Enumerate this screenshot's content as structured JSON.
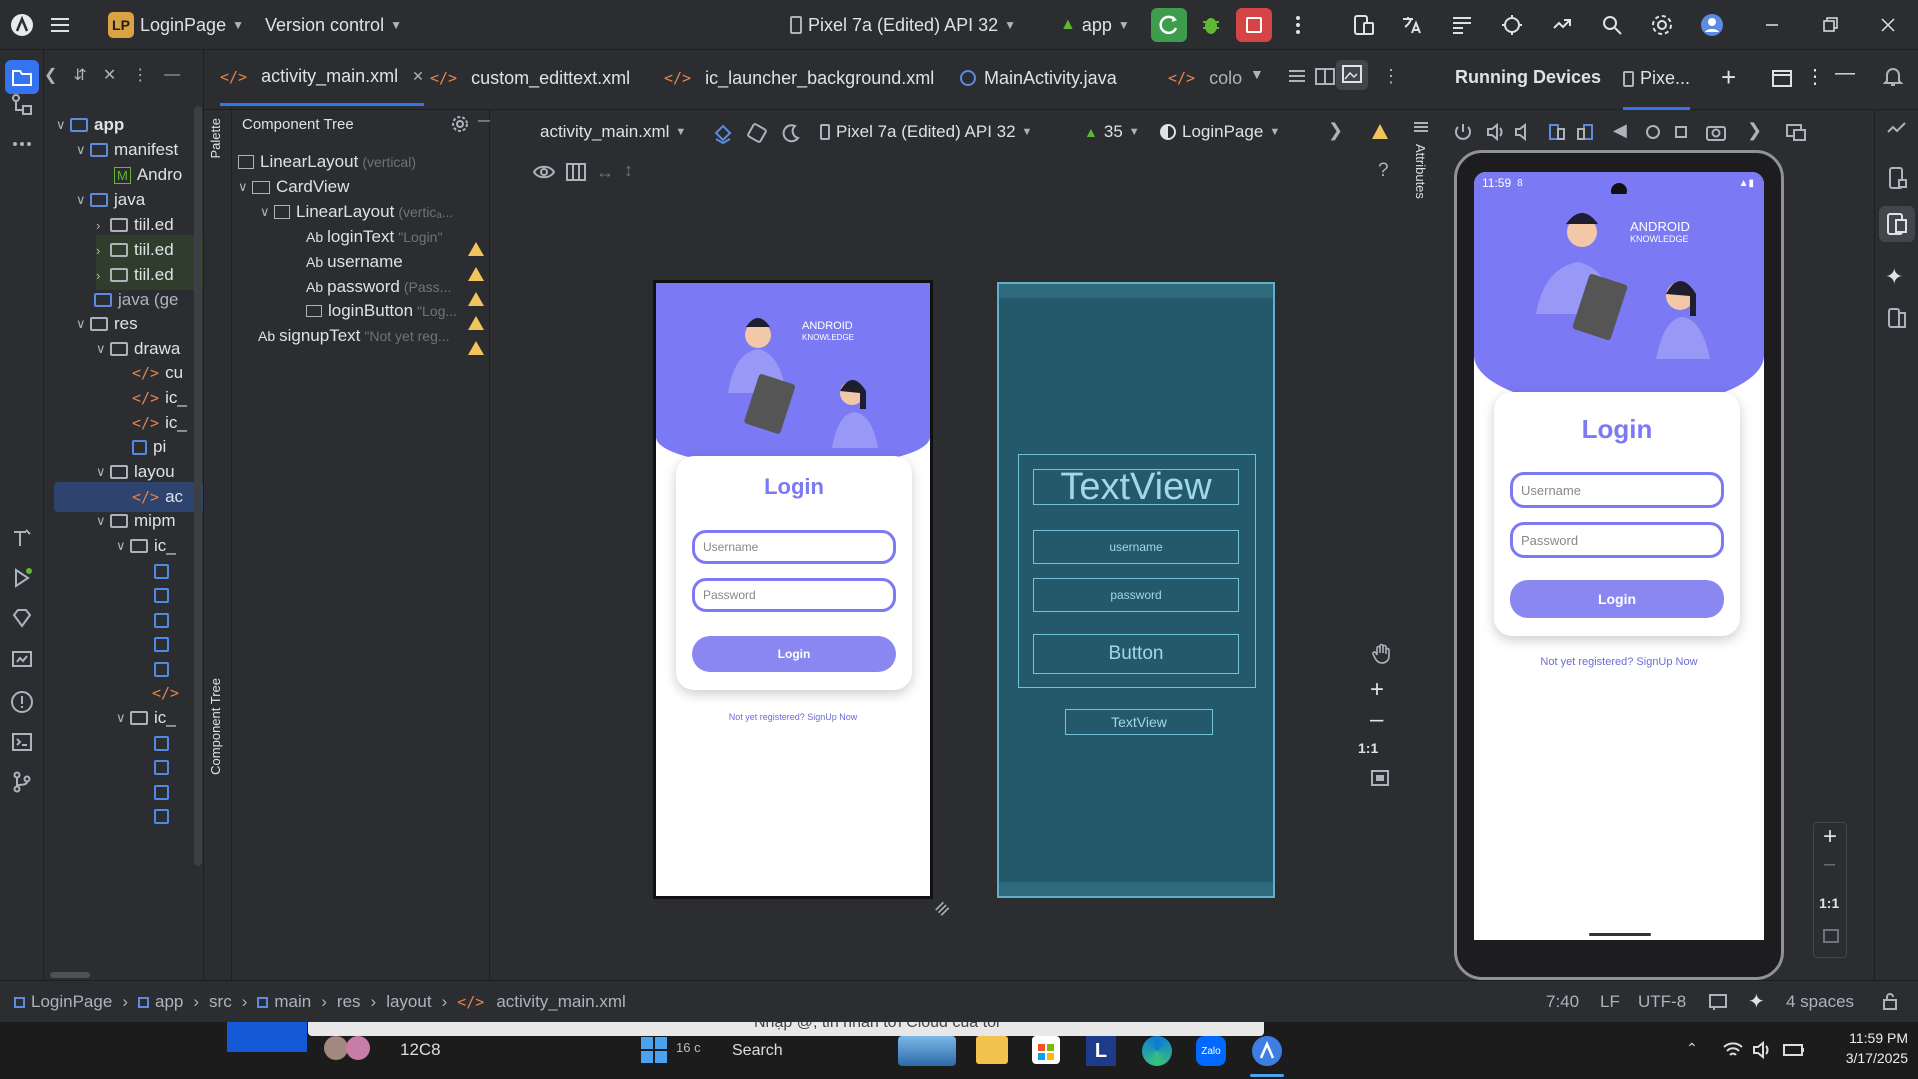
{
  "titlebar": {
    "project_badge": "LP",
    "project_name": "LoginPage",
    "vcs": "Version control",
    "device": "Pixel 7a (Edited) API 32",
    "run_config": "app"
  },
  "tabs": [
    {
      "label": "activity_main.xml"
    },
    {
      "label": "custom_edittext.xml"
    },
    {
      "label": "ic_launcher_background.xml"
    },
    {
      "label": "MainActivity.java"
    },
    {
      "label": "colo"
    }
  ],
  "project_tree": [
    {
      "label": "app"
    },
    {
      "label": "manifest"
    },
    {
      "label": "Andro"
    },
    {
      "label": "java"
    },
    {
      "label": "tiil.ed"
    },
    {
      "label": "tiil.ed"
    },
    {
      "label": "tiil.ed"
    },
    {
      "label": "java (ge"
    },
    {
      "label": "res"
    },
    {
      "label": "drawa"
    },
    {
      "label": "cu"
    },
    {
      "label": "ic_"
    },
    {
      "label": "ic_"
    },
    {
      "label": "pi"
    },
    {
      "label": "layou"
    },
    {
      "label": "ac"
    },
    {
      "label": "mipm"
    },
    {
      "label": "ic_"
    },
    {
      "label": "ic_"
    }
  ],
  "side_labels": {
    "palette": "Palette",
    "component_tree": "Component Tree",
    "attributes": "Attributes"
  },
  "component_tree": {
    "title": "Component Tree",
    "items": [
      {
        "icon": "",
        "label": "LinearLayout",
        "hint": "(vertical)"
      },
      {
        "icon": "",
        "label": "CardView",
        "hint": ""
      },
      {
        "icon": "",
        "label": "LinearLayout",
        "hint": "(verticₐ..."
      },
      {
        "icon": "Ab",
        "label": "loginText",
        "hint": "\"Login\""
      },
      {
        "icon": "Ab",
        "label": "username",
        "hint": ""
      },
      {
        "icon": "Ab",
        "label": "password",
        "hint": "(Pass..."
      },
      {
        "icon": "",
        "label": "loginButton",
        "hint": "\"Log..."
      },
      {
        "icon": "Ab",
        "label": "signupText",
        "hint": "\"Not yet reg..."
      }
    ]
  },
  "design_toolbar": {
    "file": "activity_main.xml",
    "device": "Pixel 7a (Edited) API 32",
    "api": "35",
    "theme": "LoginPage"
  },
  "design_preview": {
    "brand_line1": "ANDROID",
    "brand_line2": "KNOWLEDGE",
    "title": "Login",
    "username_placeholder": "Username",
    "password_placeholder": "Password",
    "button": "Login",
    "signup": "Not yet registered? SignUp Now"
  },
  "blueprint": {
    "title": "TextView",
    "username": "username",
    "password": "password",
    "button": "Button",
    "signup": "TextView"
  },
  "zoom": {
    "fit": "1:1"
  },
  "running_devices": {
    "title": "Running Devices",
    "tab": "Pixe...",
    "status_time": "11:59",
    "status_extra": "8"
  },
  "emulator": {
    "brand_line1": "ANDROID",
    "brand_line2": "KNOWLEDGE",
    "title": "Login",
    "username_placeholder": "Username",
    "password_placeholder": "Password",
    "button": "Login",
    "signup": "Not yet registered? SignUp Now"
  },
  "breadcrumb": [
    {
      "label": "LoginPage"
    },
    {
      "label": "app"
    },
    {
      "label": "src"
    },
    {
      "label": "main"
    },
    {
      "label": "res"
    },
    {
      "label": "layout"
    },
    {
      "label": "activity_main.xml"
    }
  ],
  "status": {
    "position": "7:40",
    "line_sep": "LF",
    "encoding": "UTF-8",
    "indent": "4 spaces"
  },
  "taskbar": {
    "chat_preview": "Nhập @, tin nhắn tới Cloud của tôi",
    "weather": "16 c",
    "search": "Search",
    "contact": "12C8",
    "time": "11:59 PM",
    "date": "3/17/2025"
  },
  "colors": {
    "accent": "#7b79f3",
    "warning": "#f2c55c",
    "blueprint": "#23596a"
  }
}
